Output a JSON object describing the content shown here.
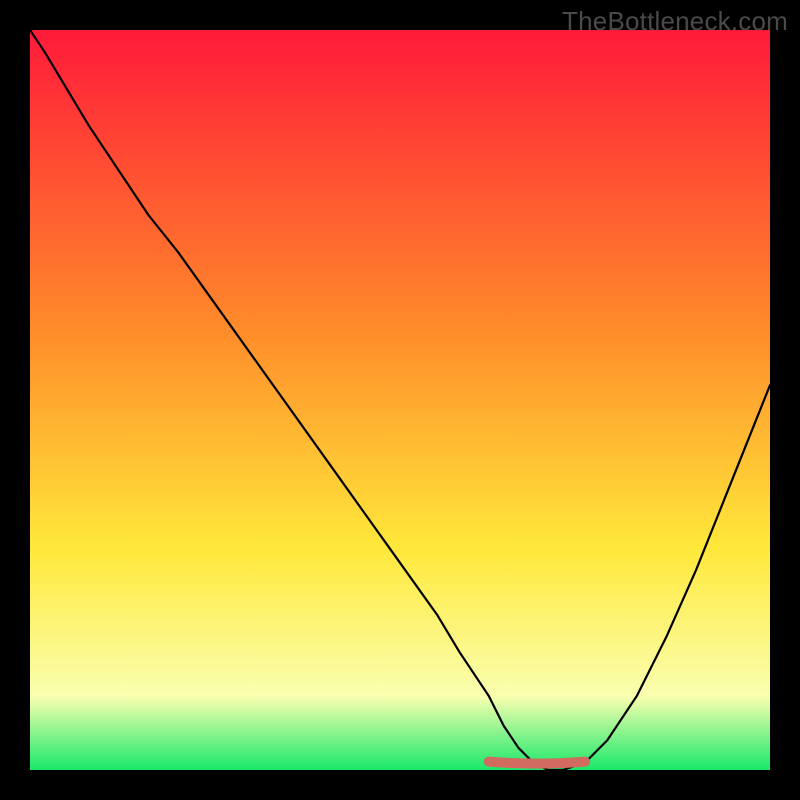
{
  "watermark": "TheBottleneck.com",
  "colors": {
    "page_bg": "#000000",
    "gradient_top": "#ff1a3a",
    "gradient_mid_upper": "#ff8a2a",
    "gradient_mid_lower": "#ffe83a",
    "gradient_pale": "#faffb0",
    "gradient_bottom": "#18e86a",
    "curve": "#000000",
    "marker": "#d16a5f"
  },
  "chart_data": {
    "type": "line",
    "title": "",
    "xlabel": "",
    "ylabel": "",
    "xlim": [
      0,
      100
    ],
    "ylim": [
      0,
      100
    ],
    "x": [
      0,
      2,
      5,
      8,
      12,
      16,
      20,
      25,
      30,
      35,
      40,
      45,
      50,
      55,
      58,
      60,
      62,
      64,
      66,
      68,
      70,
      72,
      75,
      78,
      82,
      86,
      90,
      94,
      98,
      100
    ],
    "values": [
      100,
      97,
      92,
      87,
      81,
      75,
      70,
      63,
      56,
      49,
      42,
      35,
      28,
      21,
      16,
      13,
      10,
      6,
      3,
      1,
      0,
      0,
      1,
      4,
      10,
      18,
      27,
      37,
      47,
      52
    ],
    "marker_segment": {
      "x_start": 62,
      "x_end": 75,
      "y": 1.0
    },
    "gradient_stops": [
      {
        "offset": 0.0,
        "key": "gradient_top"
      },
      {
        "offset": 0.4,
        "key": "gradient_mid_upper"
      },
      {
        "offset": 0.7,
        "key": "gradient_mid_lower"
      },
      {
        "offset": 0.9,
        "key": "gradient_pale"
      },
      {
        "offset": 1.0,
        "key": "gradient_bottom"
      }
    ]
  }
}
